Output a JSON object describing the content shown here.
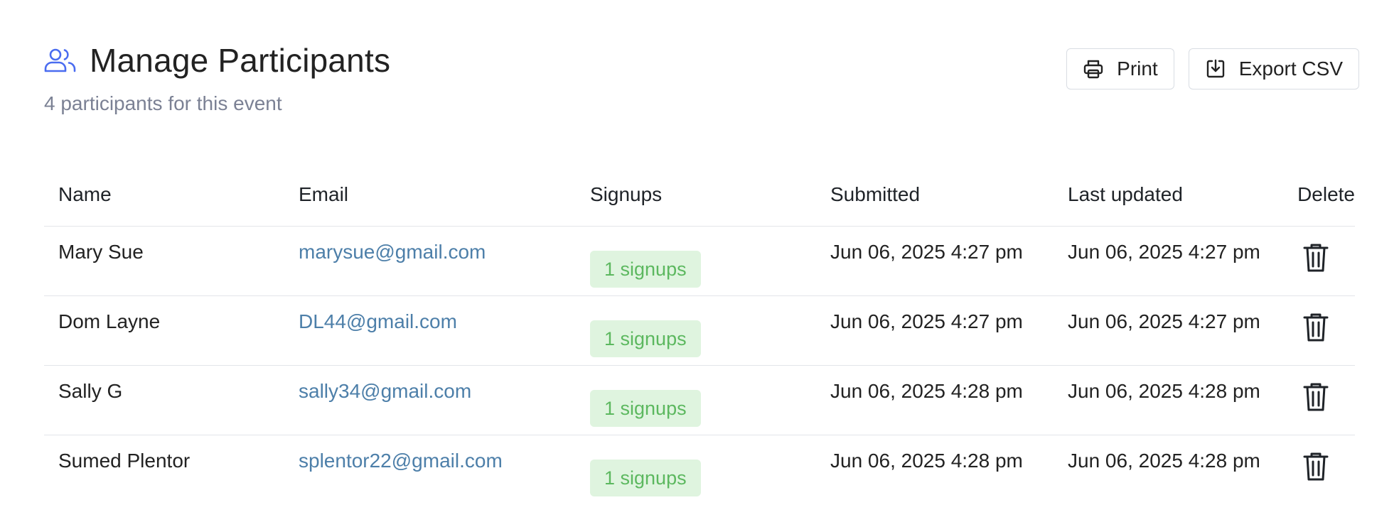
{
  "header": {
    "title": "Manage Participants",
    "title_icon": "users-icon",
    "subtitle": "4 participants for this event",
    "accent_color": "#4a6cf0"
  },
  "actions": {
    "print_label": "Print",
    "print_icon": "printer-icon",
    "export_label": "Export CSV",
    "export_icon": "download-icon"
  },
  "table": {
    "columns": [
      "Name",
      "Email",
      "Signups",
      "Submitted",
      "Last updated",
      "Delete"
    ],
    "rows": [
      {
        "name": "Mary Sue",
        "email": "marysue@gmail.com",
        "signups": "1 signups",
        "submitted": "Jun 06, 2025 4:27 pm",
        "updated": "Jun 06, 2025 4:27 pm"
      },
      {
        "name": "Dom Layne",
        "email": "DL44@gmail.com",
        "signups": "1 signups",
        "submitted": "Jun 06, 2025 4:27 pm",
        "updated": "Jun 06, 2025 4:27 pm"
      },
      {
        "name": "Sally G",
        "email": "sally34@gmail.com",
        "signups": "1 signups",
        "submitted": "Jun 06, 2025 4:28 pm",
        "updated": "Jun 06, 2025 4:28 pm"
      },
      {
        "name": "Sumed Plentor",
        "email": "splentor22@gmail.com",
        "signups": "1 signups",
        "submitted": "Jun 06, 2025 4:28 pm",
        "updated": "Jun 06, 2025 4:28 pm"
      }
    ],
    "delete_icon": "trash-icon",
    "badge_bg": "#dff4df",
    "badge_fg": "#5cb85f",
    "link_color": "#4d7fa9"
  }
}
